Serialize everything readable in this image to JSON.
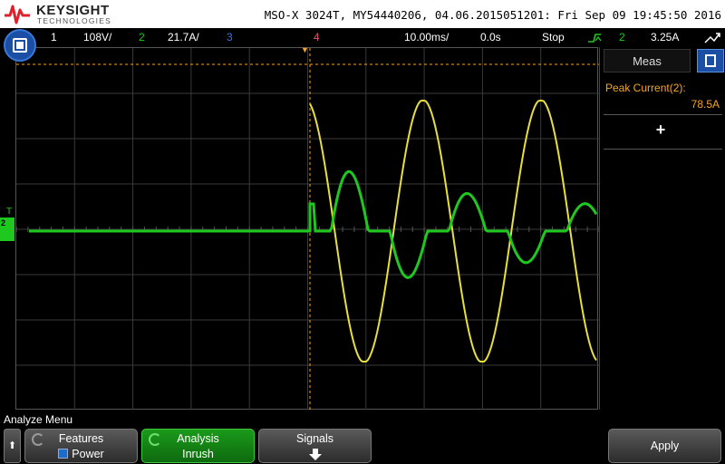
{
  "header": {
    "logo_name": "KEYSIGHT",
    "logo_sub": "TECHNOLOGIES",
    "model_info": "MSO-X 3024T, MY54440206, 04.06.2015051201: Fri Sep 09 19:45:50 2016"
  },
  "status": {
    "ch1_num": "1",
    "ch1_scale": "108V/",
    "ch2_num": "2",
    "ch2_scale": "21.7A/",
    "ch3_num": "3",
    "ch4_num": "4",
    "timebase": "10.00ms/",
    "delay": "0.0s",
    "run_state": "Stop",
    "trigger_source": "2",
    "trigger_level": "3.25A"
  },
  "plot": {
    "ch2_ground_label": "2",
    "trigger_level_label": "T"
  },
  "side_panel": {
    "tab_label": "Meas",
    "measurement_label": "Peak Current(2):",
    "measurement_value": "78.5A",
    "add_label": "+"
  },
  "menu": {
    "title": "Analyze Menu",
    "back_label": "⬆",
    "features_label": "Features",
    "features_value": "Power",
    "analysis_label": "Analysis",
    "analysis_value": "Inrush",
    "signals_label": "Signals",
    "apply_label": "Apply"
  },
  "colors": {
    "ch1": "#e8e03a",
    "ch2": "#1ec81e",
    "ch3": "#3a6fe8",
    "ch4": "#e8507a",
    "trigger": "#f5a623",
    "accent": "#1b4fa6"
  }
}
